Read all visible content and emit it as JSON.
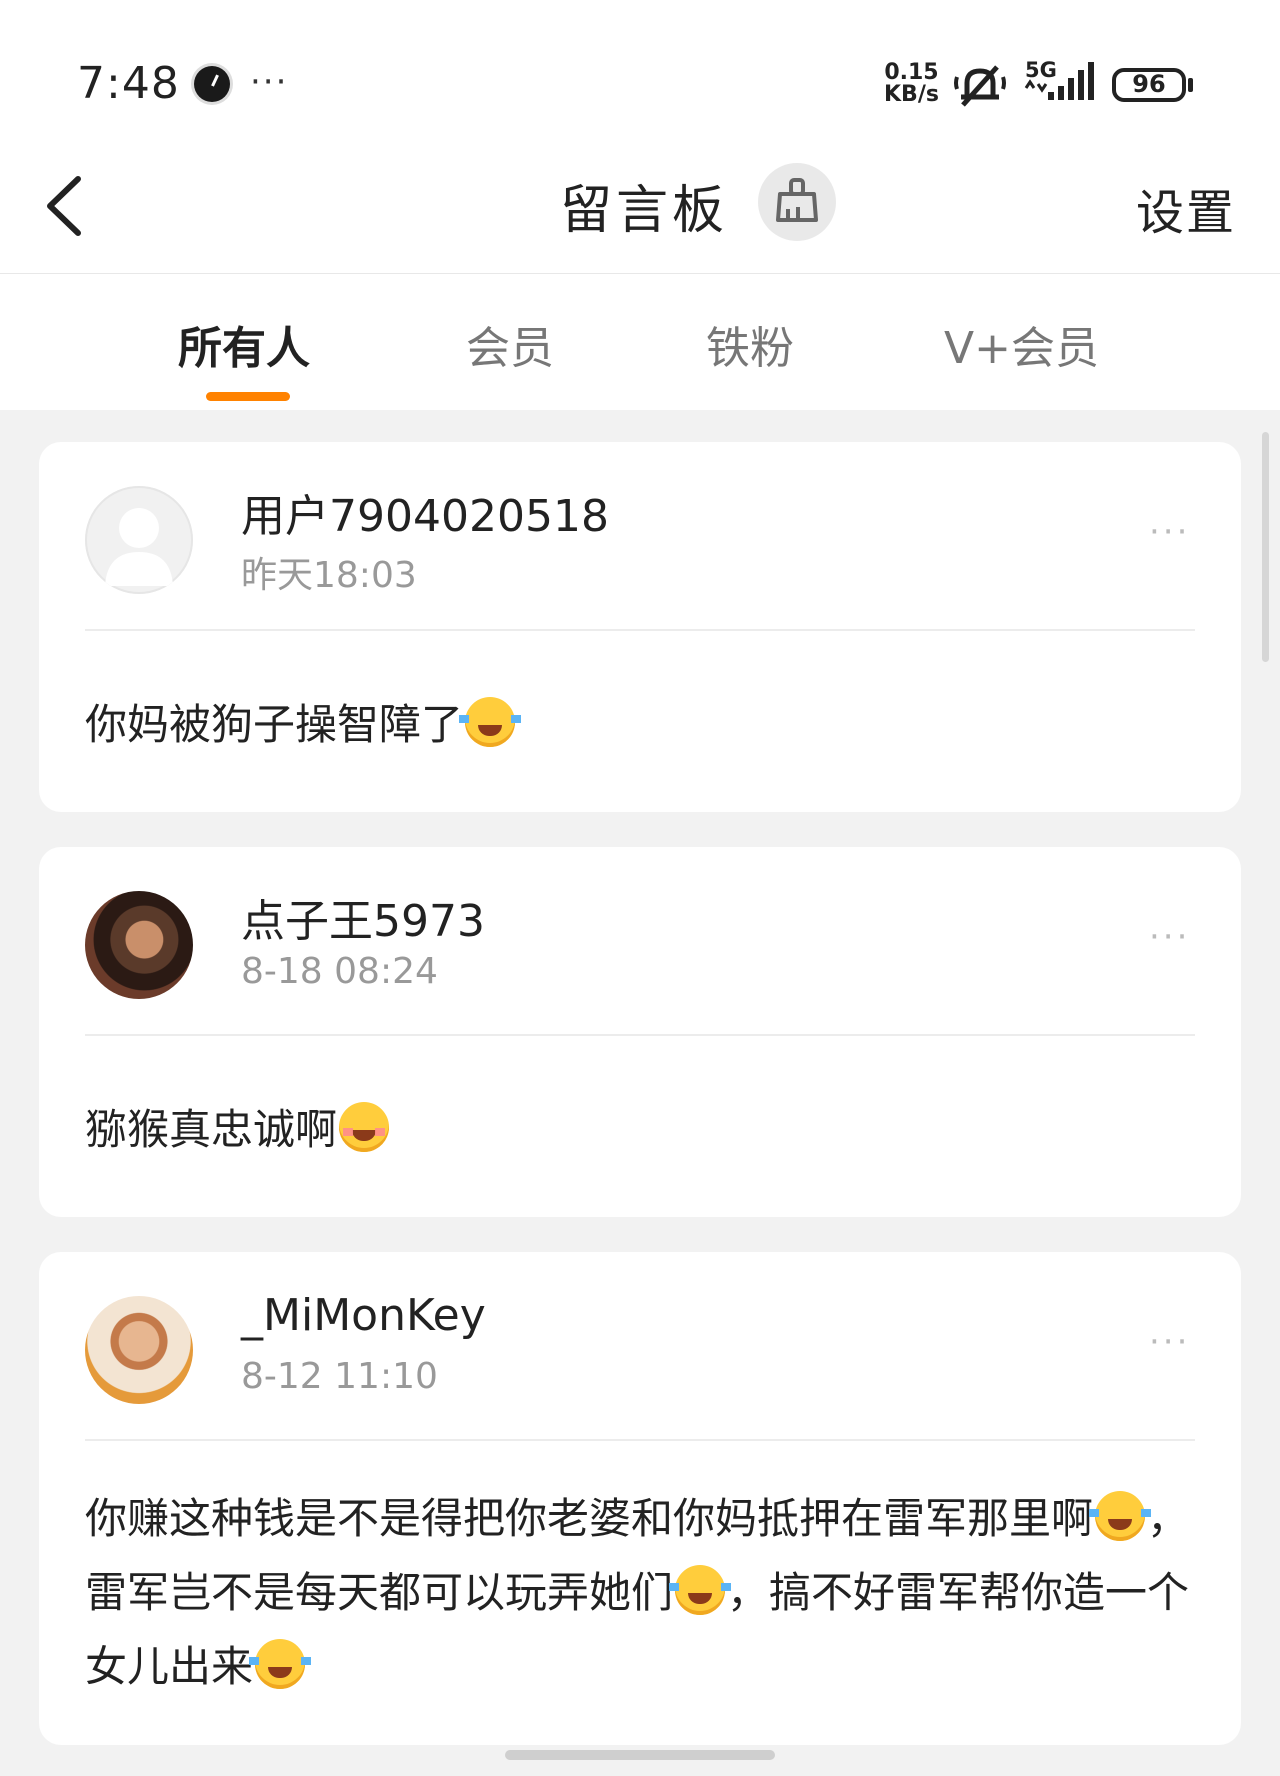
{
  "status_bar": {
    "time": "7:48",
    "dots": "···",
    "net_speed_value": "0.15",
    "net_speed_unit": "KB/s",
    "network": "5G",
    "battery": "96"
  },
  "nav": {
    "back_icon": "chevron-left-icon",
    "title": "留言板",
    "clean_icon": "broom-icon",
    "settings_label": "设置"
  },
  "tabs": [
    {
      "label": "所有人",
      "active": true
    },
    {
      "label": "会员",
      "active": false
    },
    {
      "label": "铁粉",
      "active": false
    },
    {
      "label": "V+会员",
      "active": false
    }
  ],
  "colors": {
    "accent": "#ff8200",
    "background": "#f2f2f2",
    "card": "#ffffff",
    "secondary_text": "#999999"
  },
  "messages": [
    {
      "username": "用户7904020518",
      "time": "昨天18:03",
      "avatar": "default-avatar",
      "content_parts": [
        "你妈被狗子操智障了"
      ],
      "emojis": [
        "laugh-cry-emoji"
      ]
    },
    {
      "username": "点子王5973",
      "time": "8-18 08:24",
      "avatar": "photo-avatar",
      "content_parts": [
        "猕猴真忠诚啊"
      ],
      "emojis": [
        "blush-emoji"
      ]
    },
    {
      "username": "_MiMonKey",
      "time": "8-12 11:10",
      "avatar": "photo-avatar",
      "content_parts": [
        "你赚这种钱是不是得把你老婆和你妈抵押在雷军那里啊",
        "，雷军岂不是每天都可以玩弄她们",
        "，搞不好雷军帮你造一个女儿出来"
      ],
      "emojis": [
        "laugh-cry-emoji",
        "laugh-cry-emoji",
        "laugh-cry-emoji"
      ]
    }
  ],
  "more_label": "···"
}
